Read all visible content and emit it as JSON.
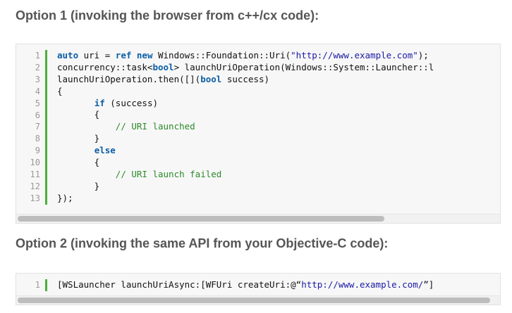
{
  "option1": {
    "heading": "Option 1 (invoking the browser from c++/cx code):",
    "line_numbers": [
      "1",
      "2",
      "3",
      "4",
      "5",
      "6",
      "7",
      "8",
      "9",
      "10",
      "11",
      "12",
      "13"
    ],
    "lines": [
      [
        {
          "t": "kw",
          "v": "auto"
        },
        {
          "t": "ty",
          "v": " uri = "
        },
        {
          "t": "kw",
          "v": "ref new"
        },
        {
          "t": "ty",
          "v": " Windows::Foundation::Uri("
        },
        {
          "t": "str",
          "v": "\"http://www.example.com\""
        },
        {
          "t": "ty",
          "v": ");"
        }
      ],
      [
        {
          "t": "ty",
          "v": "concurrency::task<"
        },
        {
          "t": "kw",
          "v": "bool"
        },
        {
          "t": "ty",
          "v": "> launchUriOperation(Windows::System::Launcher::l"
        }
      ],
      [
        {
          "t": "ty",
          "v": "launchUriOperation.then([]("
        },
        {
          "t": "kw",
          "v": "bool"
        },
        {
          "t": "ty",
          "v": " success)"
        }
      ],
      [
        {
          "t": "ty",
          "v": "{"
        }
      ],
      [
        {
          "t": "ty",
          "v": "       "
        },
        {
          "t": "kw",
          "v": "if"
        },
        {
          "t": "ty",
          "v": " (success)"
        }
      ],
      [
        {
          "t": "ty",
          "v": "       {"
        }
      ],
      [
        {
          "t": "ty",
          "v": "           "
        },
        {
          "t": "cm",
          "v": "// URI launched"
        }
      ],
      [
        {
          "t": "ty",
          "v": "       }"
        }
      ],
      [
        {
          "t": "ty",
          "v": "       "
        },
        {
          "t": "kw",
          "v": "else"
        }
      ],
      [
        {
          "t": "ty",
          "v": "       {"
        }
      ],
      [
        {
          "t": "ty",
          "v": "           "
        },
        {
          "t": "cm",
          "v": "// URI launch failed"
        }
      ],
      [
        {
          "t": "ty",
          "v": "       }"
        }
      ],
      [
        {
          "t": "ty",
          "v": "});"
        }
      ]
    ]
  },
  "option2": {
    "heading": "Option 2 (invoking the same API from your Objective-C code):",
    "line_numbers": [
      "1"
    ],
    "lines": [
      [
        {
          "t": "ty",
          "v": "[WSLauncher launchUriAsync:[WFUri createUri:@“"
        },
        {
          "t": "str",
          "v": "http://www.example.com/"
        },
        {
          "t": "ty",
          "v": "”]"
        }
      ]
    ]
  },
  "colors": {
    "keyword": "#0b5ea8",
    "string": "#1a1aa6",
    "comment": "#2b8a2b",
    "gutter_rule": "#4caf3a"
  }
}
